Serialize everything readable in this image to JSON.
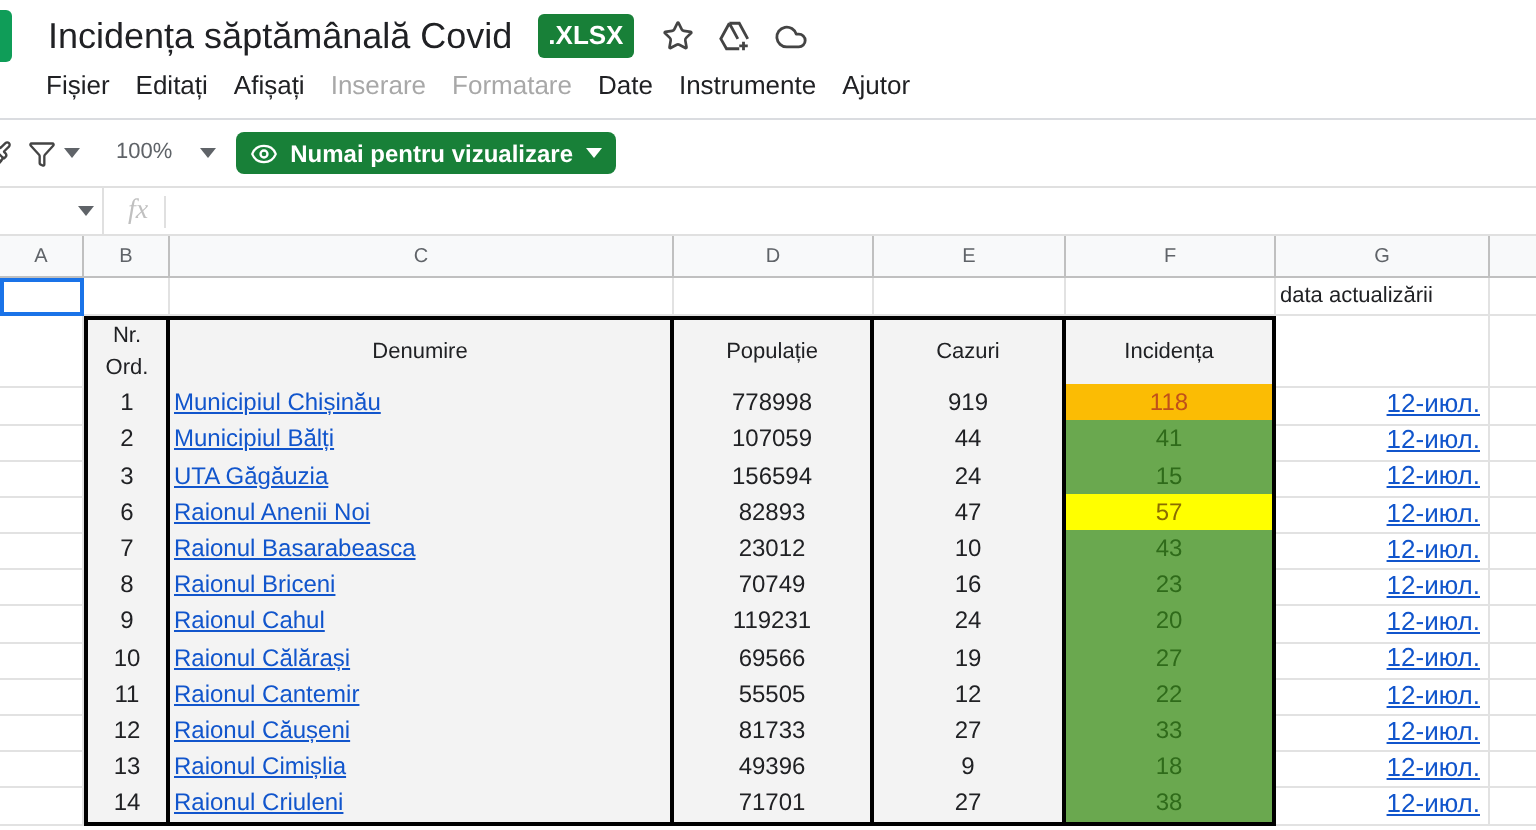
{
  "doc": {
    "title": "Incidența săptămânală Covid",
    "badge": ".XLSX"
  },
  "menu": [
    {
      "label": "Fișier",
      "disabled": false
    },
    {
      "label": "Editați",
      "disabled": false
    },
    {
      "label": "Afișați",
      "disabled": false
    },
    {
      "label": "Inserare",
      "disabled": true
    },
    {
      "label": "Formatare",
      "disabled": true
    },
    {
      "label": "Date",
      "disabled": false
    },
    {
      "label": "Instrumente",
      "disabled": false
    },
    {
      "label": "Ajutor",
      "disabled": false
    }
  ],
  "toolbar": {
    "zoom": "100%",
    "view_button": "Numai pentru vizualizare"
  },
  "formula_bar": {
    "fx": "fx"
  },
  "columns": [
    "A",
    "B",
    "C",
    "D",
    "E",
    "F",
    "G"
  ],
  "update_label": "data actualizării",
  "table": {
    "headers": [
      "Nr. Ord.",
      "Denumire",
      "Populație",
      "Cazuri",
      "Incidența"
    ],
    "rows": [
      {
        "nr": "1",
        "name": "Municipiul Chișinău",
        "population": "778998",
        "cases": "919",
        "incidence": "118",
        "kind": "high",
        "color": "#fbbc04",
        "date": "12-июл."
      },
      {
        "nr": "2",
        "name": "Municipiul Bălți",
        "population": "107059",
        "cases": "44",
        "incidence": "41",
        "kind": "low",
        "color": "#6aa84f",
        "date": "12-июл."
      },
      {
        "nr": "3",
        "name": "UTA Găgăuzia",
        "population": "156594",
        "cases": "24",
        "incidence": "15",
        "kind": "low",
        "color": "#6aa84f",
        "date": "12-июл."
      },
      {
        "nr": "6",
        "name": "Raionul Anenii Noi",
        "population": "82893",
        "cases": "47",
        "incidence": "57",
        "kind": "medium",
        "color": "#ffff00",
        "date": "12-июл."
      },
      {
        "nr": "7",
        "name": "Raionul Basarabeasca",
        "population": "23012",
        "cases": "10",
        "incidence": "43",
        "kind": "low",
        "color": "#6aa84f",
        "date": "12-июл."
      },
      {
        "nr": "8",
        "name": "Raionul Briceni",
        "population": "70749",
        "cases": "16",
        "incidence": "23",
        "kind": "low",
        "color": "#6aa84f",
        "date": "12-июл."
      },
      {
        "nr": "9",
        "name": "Raionul Cahul",
        "population": "119231",
        "cases": "24",
        "incidence": "20",
        "kind": "low",
        "color": "#6aa84f",
        "date": "12-июл."
      },
      {
        "nr": "10",
        "name": "Raionul Călărași",
        "population": "69566",
        "cases": "19",
        "incidence": "27",
        "kind": "low",
        "color": "#6aa84f",
        "date": "12-июл."
      },
      {
        "nr": "11",
        "name": "Raionul Cantemir",
        "population": "55505",
        "cases": "12",
        "incidence": "22",
        "kind": "low",
        "color": "#6aa84f",
        "date": "12-июл."
      },
      {
        "nr": "12",
        "name": "Raionul Căușeni",
        "population": "81733",
        "cases": "27",
        "incidence": "33",
        "kind": "low",
        "color": "#6aa84f",
        "date": "12-июл."
      },
      {
        "nr": "13",
        "name": "Raionul Cimișlia",
        "population": "49396",
        "cases": "9",
        "incidence": "18",
        "kind": "low",
        "color": "#6aa84f",
        "date": "12-июл."
      },
      {
        "nr": "14",
        "name": "Raionul Criuleni",
        "population": "71701",
        "cases": "27",
        "incidence": "38",
        "kind": "low",
        "color": "#6aa84f",
        "date": "12-июл."
      }
    ]
  }
}
